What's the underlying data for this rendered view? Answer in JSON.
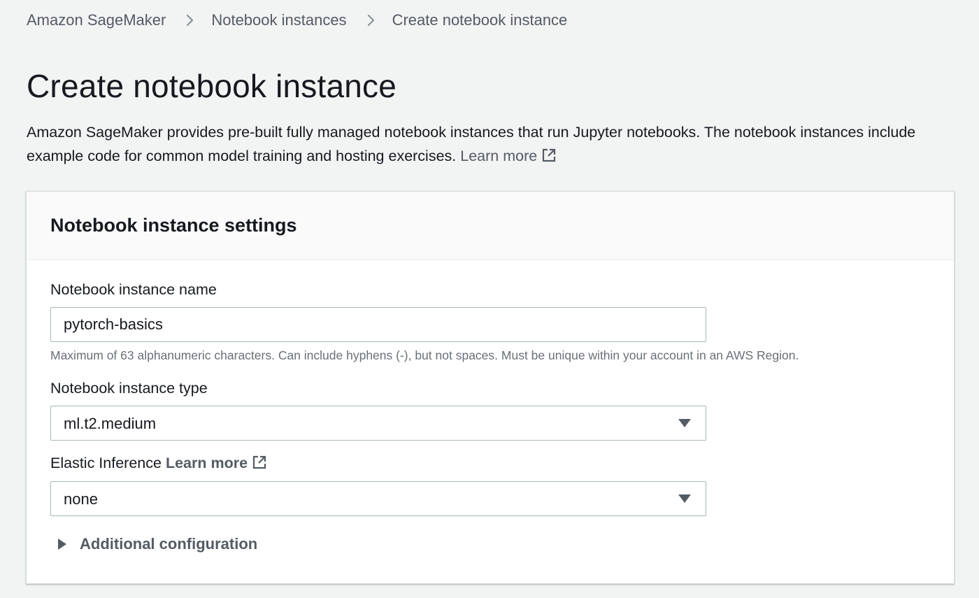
{
  "breadcrumb": {
    "items": [
      {
        "label": "Amazon SageMaker"
      },
      {
        "label": "Notebook instances"
      },
      {
        "label": "Create notebook instance"
      }
    ]
  },
  "page": {
    "title": "Create notebook instance",
    "description": "Amazon SageMaker provides pre-built fully managed notebook instances that run Jupyter notebooks. The notebook instances include example code for common model training and hosting exercises.",
    "learn_more": "Learn more"
  },
  "settings": {
    "title": "Notebook instance settings",
    "name_field": {
      "label": "Notebook instance name",
      "value": "pytorch-basics",
      "hint": "Maximum of 63 alphanumeric characters. Can include hyphens (-), but not spaces. Must be unique within your account in an AWS Region."
    },
    "type_field": {
      "label": "Notebook instance type",
      "value": "ml.t2.medium"
    },
    "inference_field": {
      "label": "Elastic Inference",
      "learn_more": "Learn more",
      "value": "none"
    },
    "additional": {
      "label": "Additional configuration",
      "expanded": false
    }
  },
  "icons": {
    "breadcrumb_separator": "chevron-right-icon",
    "external_link": "external-link-icon",
    "dropdown": "caret-down-icon",
    "expander": "caret-right-icon"
  },
  "colors": {
    "background": "#f2f3f3",
    "panel": "#ffffff",
    "panel_header": "#fafafa",
    "text": "#16191f",
    "muted_text": "#545b64",
    "hint_text": "#687078",
    "input_border": "#aab7b8"
  }
}
